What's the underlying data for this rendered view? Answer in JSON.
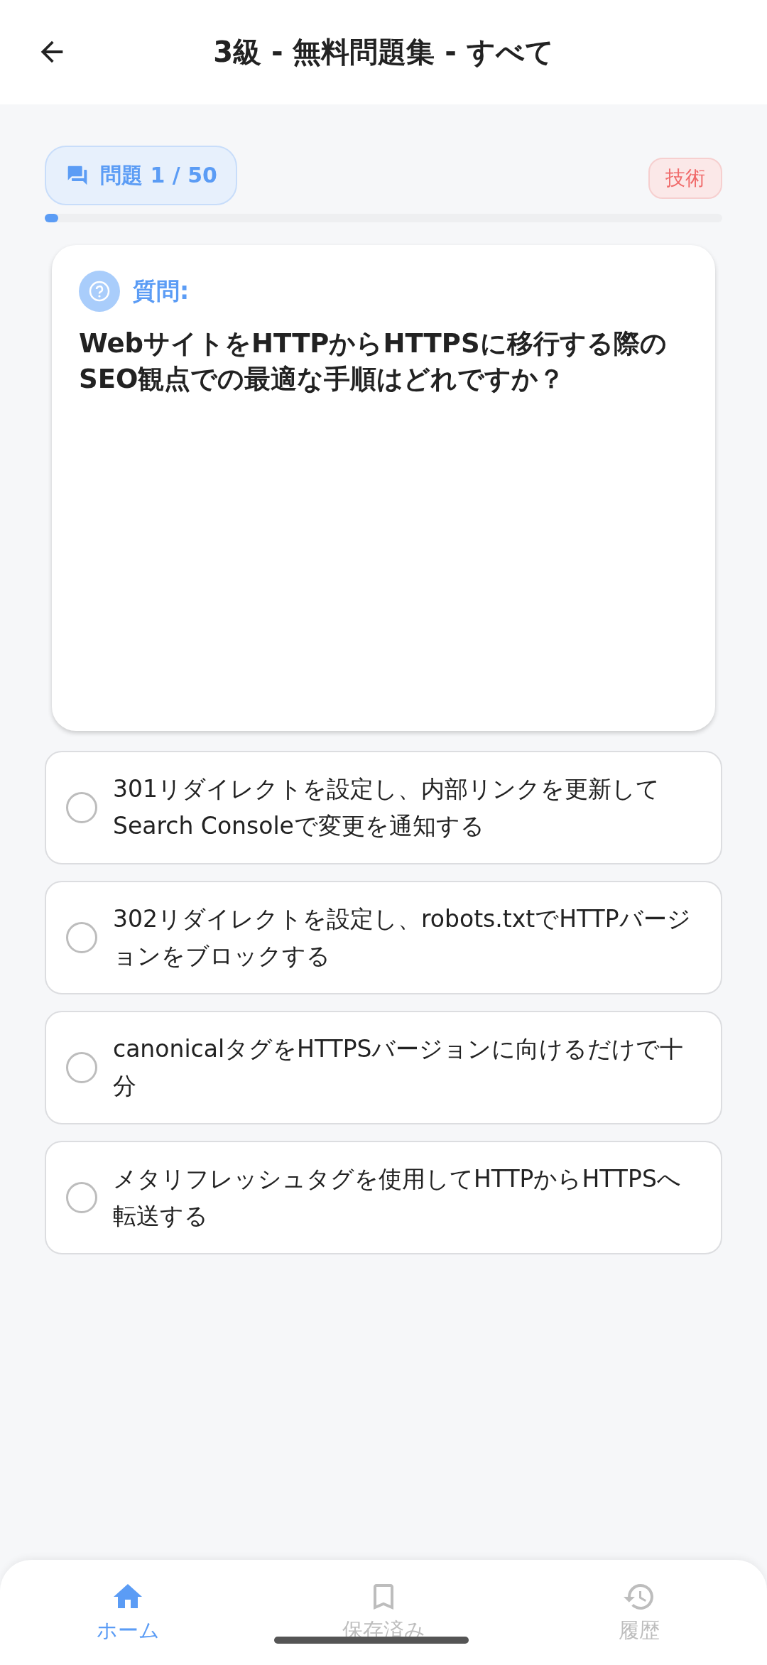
{
  "header": {
    "title": "3級 - 無料問題集 - すべて"
  },
  "progress": {
    "label": "問題 1 / 50",
    "category": "技術",
    "level": 0.02
  },
  "question": {
    "heading": "質問:",
    "text": "WebサイトをHTTPからHTTPSに移行する際のSEO観点での最適な手順はどれですか？"
  },
  "options": [
    {
      "text": "301リダイレクトを設定し、内部リンクを更新してSearch Consoleで変更を通知する",
      "selected": false
    },
    {
      "text": "302リダイレクトを設定し、robots.txtでHTTPバージョンをブロックする",
      "selected": false
    },
    {
      "text": "canonicalタグをHTTPSバージョンに向けるだけで十分",
      "selected": false
    },
    {
      "text": "メタリフレッシュタグを使用してHTTPからHTTPSへ転送する",
      "selected": false
    }
  ],
  "nav": [
    {
      "kind": "home",
      "label": "ホーム",
      "selected": true
    },
    {
      "kind": "saved",
      "label": "保存済み",
      "selected": false
    },
    {
      "kind": "history",
      "label": "履歴",
      "selected": false
    }
  ]
}
